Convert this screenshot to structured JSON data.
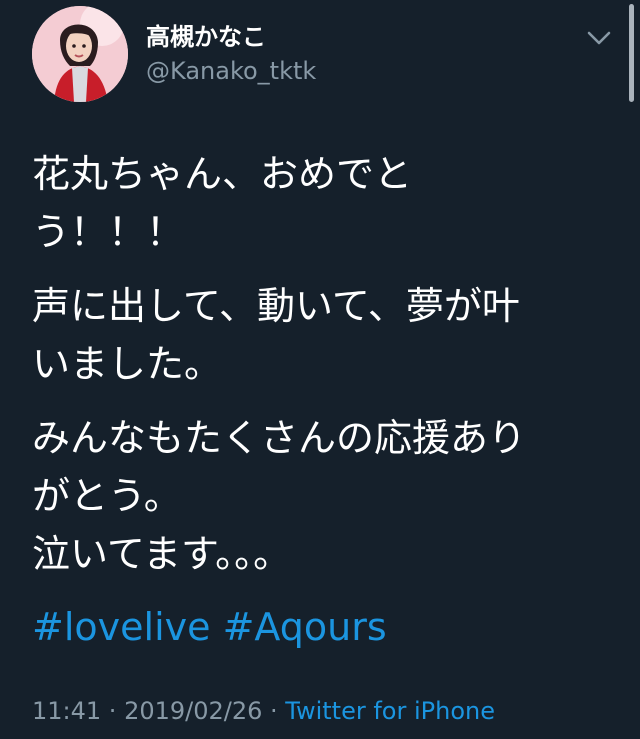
{
  "user": {
    "display_name": "高槻かなこ",
    "handle": "@Kanako_tktk"
  },
  "tweet": {
    "paragraphs": [
      "花丸ちゃん、おめでと\nう！！！",
      "声に出して、動いて、夢が叶\nいました。",
      "みんなもたくさんの応援あり\nがとう。",
      "泣いてます。。。"
    ],
    "hashtags": [
      "#lovelive",
      "#Aqours"
    ]
  },
  "meta": {
    "time": "11:41",
    "separator": " · ",
    "date": "2019/02/26",
    "source": "Twitter for iPhone"
  },
  "icons": {
    "menu": "chevron-down-icon"
  },
  "colors": {
    "background": "#15202b",
    "text": "#ffffff",
    "secondary": "#8899a6",
    "link": "#1b95e0"
  }
}
